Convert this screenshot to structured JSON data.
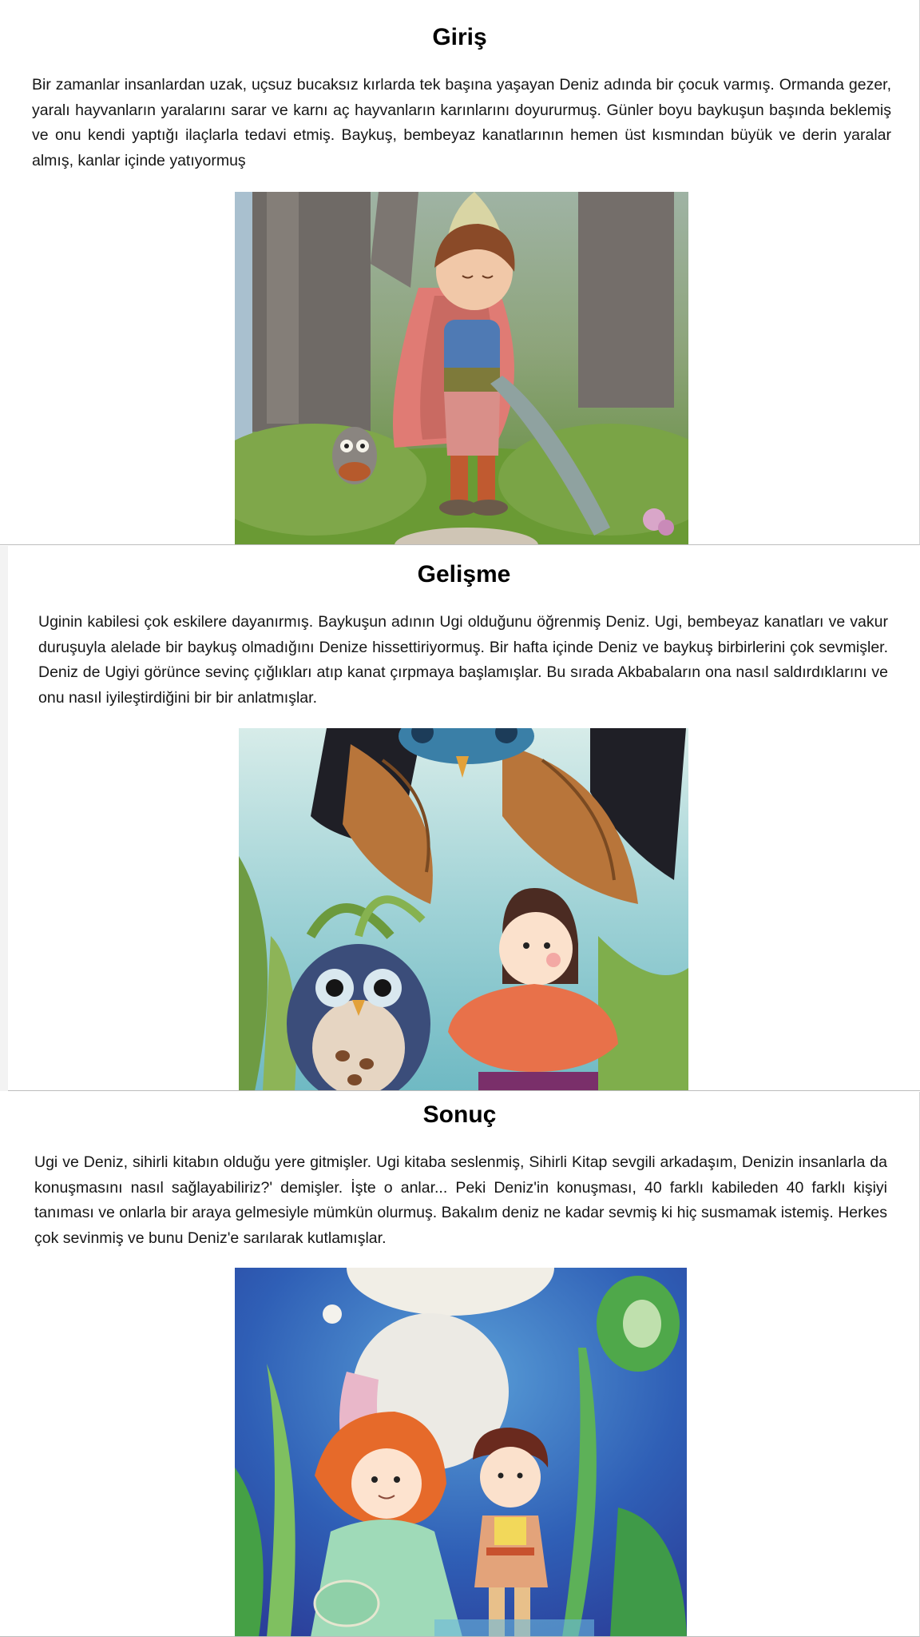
{
  "sections": [
    {
      "title": "Giriş",
      "text": "Bir zamanlar insanlardan uzak, uçsuz bucaksız kırlarda tek başına yaşayan Deniz adında bir çocuk varmış. Ormanda gezer, yaralı hayvanların yaralarını sarar ve karnı aç hayvanların karınlarını doyururmuş. Günler boyu baykuşun başında beklemiş ve onu kendi yaptığı ilaçlarla tedavi etmiş. Baykuş, bembeyaz kanatlarının hemen üst kısmından büyük ve derin yaralar almış, kanlar içinde yatıyormuş"
    },
    {
      "title": "Gelişme",
      "text": "Uginin kabilesi çok eskilere dayanırmış. Baykuşun adının Ugi olduğunu öğrenmiş Deniz. Ugi, bembeyaz kanatları ve vakur duruşuyla alelade bir baykuş olmadığını Denize hissettiriyormuş. Bir hafta içinde Deniz ve baykuş birbirlerini çok sevmişler. Deniz de Ugiyi görünce sevinç çığlıkları atıp kanat çırpmaya başlamışlar. Bu sırada Akbabaların ona nasıl saldırdıklarını ve onu nasıl iyileştirdiğini bir bir anlatmışlar."
    },
    {
      "title": "Sonuç",
      "text": "Ugi ve Deniz, sihirli kitabın olduğu yere gitmişler. Ugi kitaba seslenmiş, Sihirli Kitap sevgili arkadaşım, Denizin insanlarla da konuşmasını nasıl sağlayabiliriz?' demişler. İşte o anlar... Peki Deniz'in konuşması, 40 farklı kabileden 40 farklı kişiyi tanıması ve onlarla bir araya gelmesiyle mümkün olurmuş. Bakalım deniz ne kadar sevmiş ki hiç susmamak istemiş. Herkes çok sevinmiş ve bunu Deniz'e sarılarak kutlamışlar."
    }
  ],
  "colors": {
    "page_background": "#ffffff",
    "divider": "#bdbdbd",
    "text": "#161616"
  }
}
